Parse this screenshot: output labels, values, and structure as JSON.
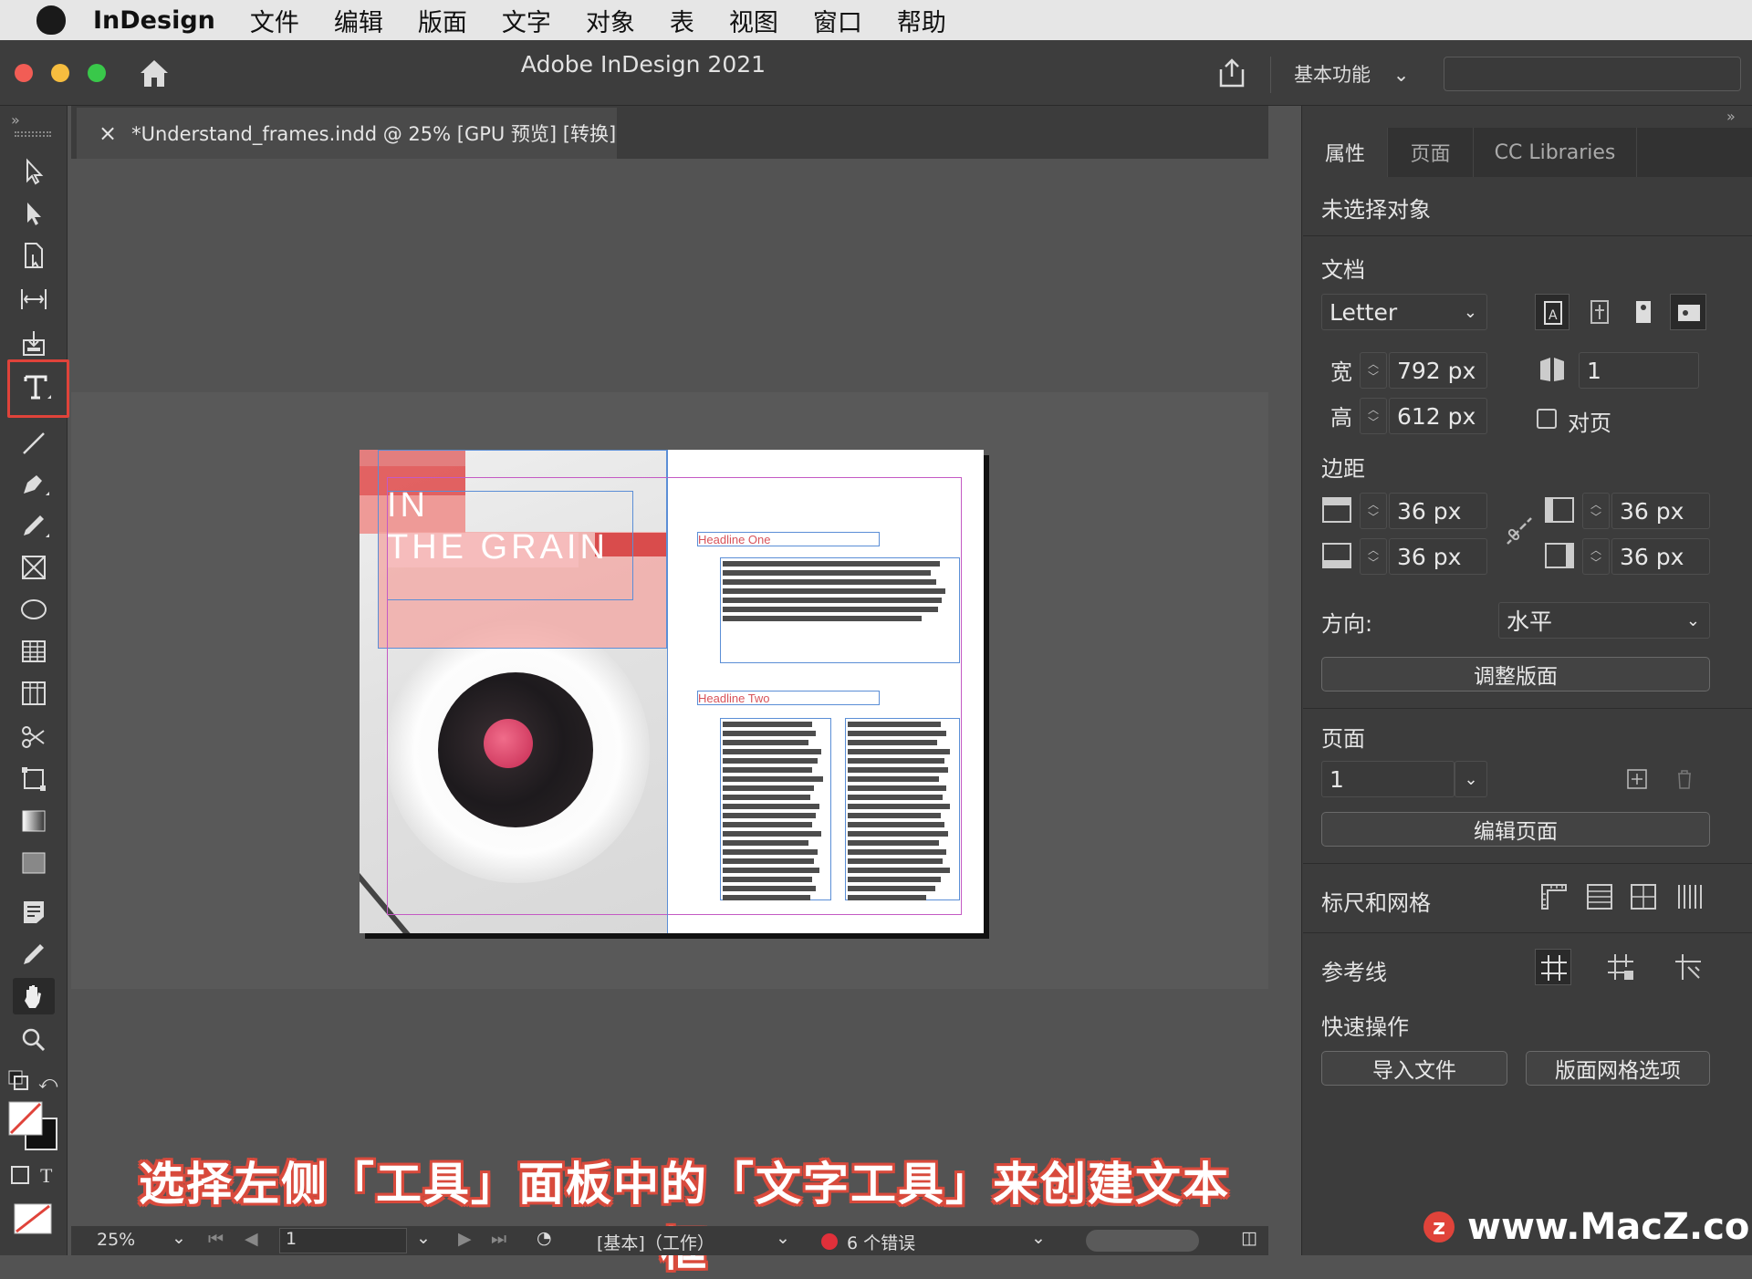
{
  "menubar": {
    "app": "InDesign",
    "items": [
      "文件",
      "编辑",
      "版面",
      "文字",
      "对象",
      "表",
      "视图",
      "窗口",
      "帮助"
    ]
  },
  "window": {
    "title": "Adobe InDesign 2021",
    "workspace": "基本功能"
  },
  "document_tab": {
    "close_glyph": "×",
    "title": "*Understand_frames.indd @ 25% [GPU 预览] [转换]"
  },
  "page": {
    "title_line1": "IN",
    "title_line2": "THE GRAIN",
    "headline_one": "Headline One",
    "headline_two": "Headline Two"
  },
  "panel": {
    "tabs": [
      "属性",
      "页面",
      "CC Libraries"
    ],
    "no_selection": "未选择对象",
    "document_label": "文档",
    "page_size": "Letter",
    "width_label": "宽",
    "width_value": "792 px",
    "height_label": "高",
    "height_value": "612 px",
    "pages_count": "1",
    "facing_pages_label": "对页",
    "margins_label": "边距",
    "margin_top": "36 px",
    "margin_bottom": "36 px",
    "margin_left": "36 px",
    "margin_right": "36 px",
    "orientation_label": "方向:",
    "orientation_value": "水平",
    "adjust_layout_button": "调整版面",
    "pages_label": "页面",
    "page_select_value": "1",
    "edit_page_button": "编辑页面",
    "rulers_grids_label": "标尺和网格",
    "guides_label": "参考线",
    "quick_actions_label": "快速操作",
    "import_file_button": "导入文件",
    "layout_grid_button": "版面网格选项"
  },
  "statusbar": {
    "zoom": "25%",
    "page": "1",
    "style": "[基本]（工作）",
    "errors": "6 个错误"
  },
  "caption": "选择左侧「工具」面板中的「文字工具」来创建文本框",
  "watermark": "www.MacZ.com",
  "colors": {
    "accent_red": "#e0433a",
    "frame_blue": "#5b8ed6",
    "margin_magenta": "#c45ac4"
  }
}
